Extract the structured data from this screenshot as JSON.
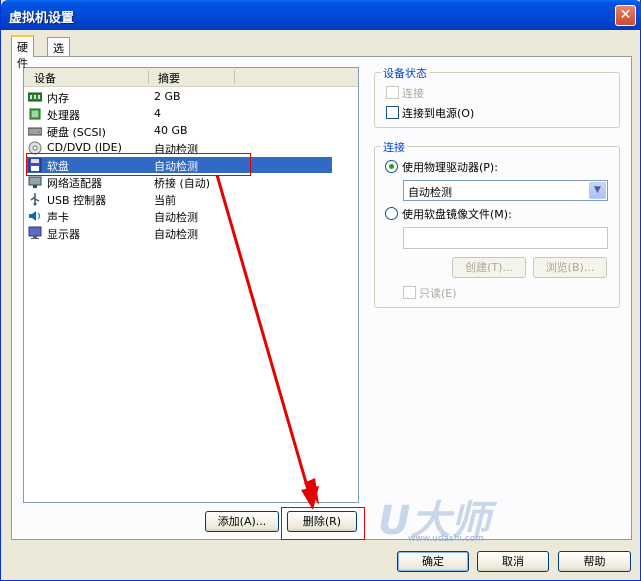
{
  "window": {
    "title": "虚拟机设置",
    "close_glyph": "✕"
  },
  "tabs": [
    {
      "label": "硬件"
    },
    {
      "label": "选项"
    }
  ],
  "device_list": {
    "columns": {
      "device": "设备",
      "summary": "摘要"
    },
    "rows": [
      {
        "device": "内存",
        "summary": "2 GB",
        "icon": "memory-icon"
      },
      {
        "device": "处理器",
        "summary": "4",
        "icon": "processor-icon"
      },
      {
        "device": "硬盘 (SCSI)",
        "summary": "40 GB",
        "icon": "harddisk-icon"
      },
      {
        "device": "CD/DVD (IDE)",
        "summary": "自动检测",
        "icon": "cd-dvd-icon"
      },
      {
        "device": "软盘",
        "summary": "自动检测",
        "icon": "floppy-icon",
        "selected": true
      },
      {
        "device": "网络适配器",
        "summary": "桥接 (自动)",
        "icon": "network-adapter-icon"
      },
      {
        "device": "USB 控制器",
        "summary": "当前",
        "icon": "usb-icon"
      },
      {
        "device": "声卡",
        "summary": "自动检测",
        "icon": "sound-card-icon"
      },
      {
        "device": "显示器",
        "summary": "自动检测",
        "icon": "monitor-icon"
      }
    ]
  },
  "list_buttons": {
    "add": "添加(A)...",
    "remove": "删除(R)"
  },
  "device_status": {
    "title": "设备状态",
    "connected": {
      "label": "连接",
      "checked": false,
      "enabled": false
    },
    "connect_on_power": {
      "label": "连接到电源(O)",
      "checked": false,
      "enabled": true
    }
  },
  "connection": {
    "title": "连接",
    "use_physical": {
      "label": "使用物理驱动器(P):",
      "selected": true
    },
    "physical_select_value": "自动检测",
    "use_image": {
      "label": "使用软盘镜像文件(M):",
      "selected": false
    },
    "image_path_value": "",
    "create_button": "创建(T)...",
    "browse_button": "浏览(B)...",
    "readonly": {
      "label": "只读(E)",
      "checked": false,
      "enabled": false
    }
  },
  "watermark": {
    "logo": "U大师",
    "url": "www.udashi.com"
  },
  "footer_buttons": {
    "ok": "确定",
    "cancel": "取消",
    "help": "帮助"
  },
  "colors": {
    "selection": "#316ac5",
    "annotation_red": "#e60000",
    "titlebar": "#0049d6",
    "group_title": "#0046d5"
  }
}
